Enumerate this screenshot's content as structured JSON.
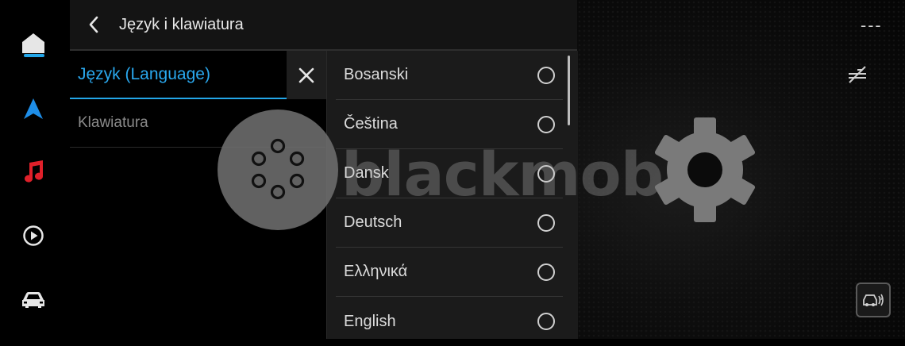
{
  "header": {
    "title": "Język i klawiatura"
  },
  "menu": {
    "items": [
      {
        "label": "Język (Language)"
      },
      {
        "label": "Klawiatura"
      }
    ]
  },
  "languages": [
    {
      "label": "Bosanski",
      "selected": false
    },
    {
      "label": "Čeština",
      "selected": false
    },
    {
      "label": "Dansk",
      "selected": false
    },
    {
      "label": "Deutsch",
      "selected": false
    },
    {
      "label": "Ελληνικά",
      "selected": false
    },
    {
      "label": "English",
      "selected": false
    }
  ],
  "status": {
    "dashes": "---"
  },
  "watermark": {
    "text": "blackmobile"
  },
  "icons": {
    "rail": [
      "home-icon",
      "navigation-icon",
      "music-icon",
      "play-icon",
      "car-icon"
    ],
    "header": "back-chevron-icon",
    "close": "close-icon",
    "right": [
      "cruise-control-off-icon",
      "park-assist-icon"
    ],
    "overlay": [
      "loading-spinner-icon",
      "settings-gear-icon"
    ]
  },
  "colors": {
    "accent": "#23a6e8",
    "music": "#e0202a",
    "panel": "#1b1b1b",
    "header": "#141414"
  }
}
